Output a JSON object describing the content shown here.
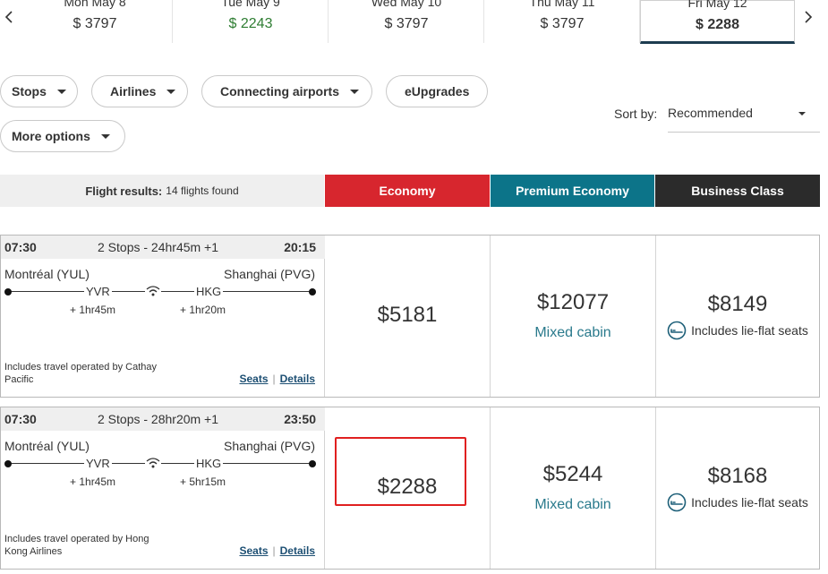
{
  "dates": [
    {
      "label": "Mon May 8",
      "price": "$ 3797",
      "low": false,
      "selected": false
    },
    {
      "label": "Tue May 9",
      "price": "$ 2243",
      "low": true,
      "selected": false
    },
    {
      "label": "Wed May 10",
      "price": "$ 3797",
      "low": false,
      "selected": false
    },
    {
      "label": "Thu May 11",
      "price": "$ 3797",
      "low": false,
      "selected": false
    },
    {
      "label": "Fri May 12",
      "price": "$ 2288",
      "low": false,
      "selected": true
    }
  ],
  "filters": {
    "stops": "Stops",
    "airlines": "Airlines",
    "connecting": "Connecting airports",
    "eupgrades": "eUpgrades",
    "more": "More options"
  },
  "sort": {
    "label": "Sort by:",
    "value": "Recommended"
  },
  "results": {
    "title": "Flight results:",
    "count": "14 flights found"
  },
  "cabins": {
    "economy": "Economy",
    "premium": "Premium Economy",
    "business": "Business Class"
  },
  "colors": {
    "economy": "#d7262e",
    "premium": "#0c7489",
    "business": "#2b2b2b",
    "highlight": "#e02020"
  },
  "flights": [
    {
      "depart": "07:30",
      "stops": "2 Stops - 24hr45m +1",
      "arrive": "20:15",
      "origin": "Montréal (YUL)",
      "destination": "Shanghai (PVG)",
      "via1": "YVR",
      "via2": "HKG",
      "lay1": "+ 1hr45m",
      "lay2": "+ 1hr20m",
      "operated": "Includes travel operated by Cathay Pacific",
      "seats": "Seats",
      "details": "Details",
      "economy": "$5181",
      "premium": "$12077",
      "premium_note": "Mixed cabin",
      "business": "$8149",
      "business_note": "Includes lie-flat seats"
    },
    {
      "depart": "07:30",
      "stops": "2 Stops - 28hr20m +1",
      "arrive": "23:50",
      "origin": "Montréal (YUL)",
      "destination": "Shanghai (PVG)",
      "via1": "YVR",
      "via2": "HKG",
      "lay1": "+ 1hr45m",
      "lay2": "+ 5hr15m",
      "operated": "Includes travel operated by Hong Kong Airlines",
      "seats": "Seats",
      "details": "Details",
      "economy": "$2288",
      "premium": "$5244",
      "premium_note": "Mixed cabin",
      "business": "$8168",
      "business_note": "Includes lie-flat seats"
    }
  ]
}
